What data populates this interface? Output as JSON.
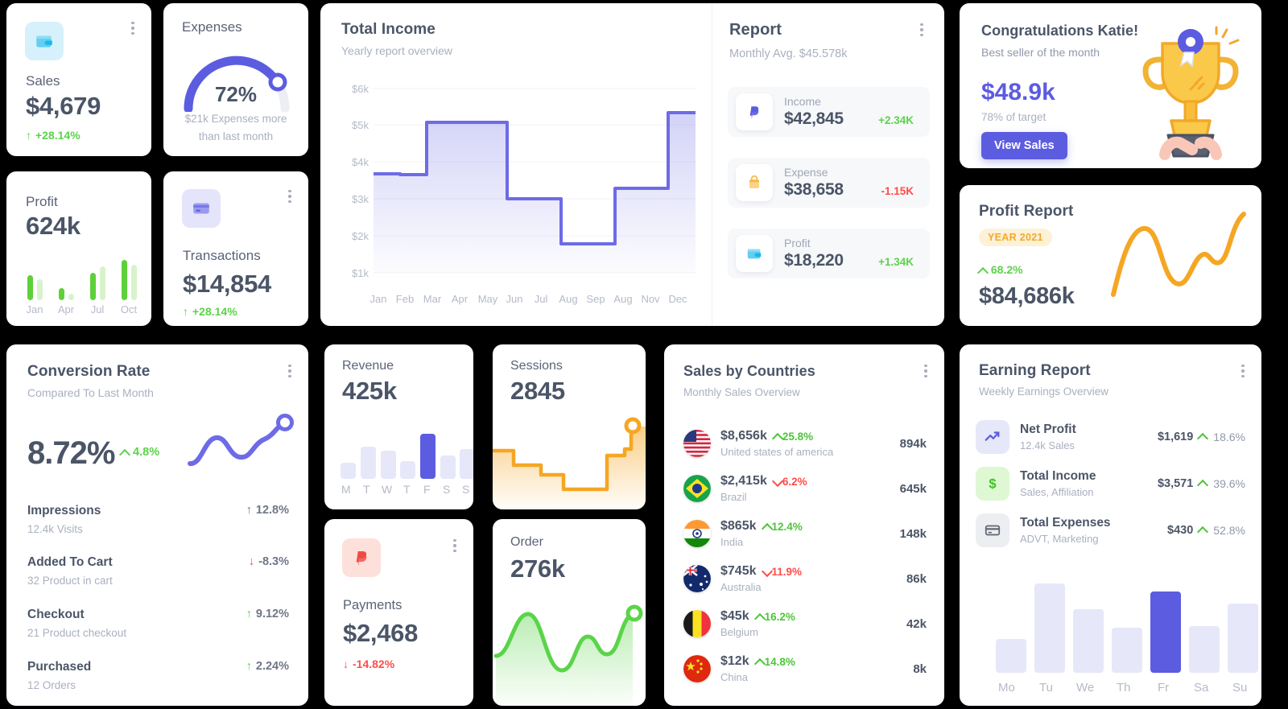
{
  "sales": {
    "icon": "wallet-icon",
    "label": "Sales",
    "value": "$4,679",
    "delta": "+28.14%"
  },
  "expenses": {
    "title": "Expenses",
    "percent": "72%",
    "percent_value": 72,
    "note_line1": "$21k Expenses more",
    "note_line2": "than last month"
  },
  "profit": {
    "label": "Profit",
    "value": "624k",
    "chart": {
      "type": "bar",
      "categories": [
        "Jan",
        "Apr",
        "Jul",
        "Oct"
      ],
      "series": [
        {
          "name": "primary",
          "color": "#5dd139",
          "values": [
            46,
            22,
            50,
            72
          ]
        },
        {
          "name": "secondary",
          "color": "#d8f3cb",
          "values": [
            38,
            12,
            62,
            64
          ]
        }
      ],
      "ylim": [
        0,
        80
      ]
    }
  },
  "transactions": {
    "icon": "credit-card-icon",
    "label": "Transactions",
    "value": "$14,854",
    "delta": "+28.14%"
  },
  "total_income": {
    "title": "Total Income",
    "subtitle": "Yearly report overview",
    "chart_data": {
      "type": "area",
      "title": "Total Income",
      "subtitle": "Yearly report overview",
      "xlabel": "",
      "ylabel": "",
      "categories": [
        "Jan",
        "Feb",
        "Mar",
        "Apr",
        "May",
        "Jun",
        "Jul",
        "Aug",
        "Sep",
        "Aug",
        "Nov",
        "Dec"
      ],
      "ytick_labels": [
        "$6k",
        "$5k",
        "$4k",
        "$3k",
        "$2k",
        "$1k"
      ],
      "yticks": [
        6000,
        5000,
        4000,
        3000,
        2000,
        1000
      ],
      "ylim": [
        1000,
        6000
      ],
      "values": [
        3300,
        3280,
        4680,
        4680,
        2980,
        2980,
        1760,
        1760,
        3580,
        3580,
        5700,
        5700
      ],
      "line_color": "#6d6be6",
      "grid": true,
      "legend": "none"
    }
  },
  "report": {
    "title": "Report",
    "subtitle": "Monthly Avg. $45.578k",
    "rows": [
      {
        "icon": "paypal-icon",
        "label": "Income",
        "value": "$42,845",
        "delta": "+2.34K",
        "dir": "up"
      },
      {
        "icon": "bag-icon",
        "label": "Expense",
        "value": "$38,658",
        "delta": "-1.15K",
        "dir": "down"
      },
      {
        "icon": "wallet-icon",
        "label": "Profit",
        "value": "$18,220",
        "delta": "+1.34K",
        "dir": "up"
      }
    ]
  },
  "congrats": {
    "title": "Congratulations Katie!",
    "subtitle": "Best seller of the month",
    "amount": "$48.9k",
    "target": "78% of target",
    "button": "View Sales",
    "illustration": "trophy-icon"
  },
  "profit_report": {
    "title": "Profit Report",
    "badge": "YEAR 2021",
    "delta": "68.2%",
    "value": "$84,686k",
    "chart": {
      "type": "line",
      "color": "#f5a623",
      "points": [
        20,
        14,
        8,
        22,
        32,
        24,
        14,
        20,
        4
      ]
    }
  },
  "conversion_rate": {
    "title": "Conversion Rate",
    "subtitle": "Compared To Last Month",
    "value": "8.72%",
    "delta": "4.8%",
    "chart": {
      "type": "line",
      "color": "#6d6be6"
    },
    "rows": [
      {
        "label": "Impressions",
        "sub": "12.4k Visits",
        "pct": "12.8%",
        "dir": "up"
      },
      {
        "label": "Added To Cart",
        "sub": "32 Product in cart",
        "pct": "-8.3%",
        "dir": "down"
      },
      {
        "label": "Checkout",
        "sub": "21 Product checkout",
        "pct": "9.12%",
        "dir": "up"
      },
      {
        "label": "Purchased",
        "sub": "12 Orders",
        "pct": "2.24%",
        "dir": "up"
      }
    ]
  },
  "revenue": {
    "label": "Revenue",
    "value": "425k",
    "chart": {
      "type": "bar",
      "categories": [
        "M",
        "T",
        "W",
        "T",
        "F",
        "S",
        "S"
      ],
      "values": [
        30,
        62,
        55,
        34,
        86,
        46,
        58
      ],
      "highlight_index": 4,
      "bar_color": "#e6e7f9",
      "highlight_color": "#5c5ce0",
      "ylim": [
        0,
        100
      ]
    }
  },
  "sessions": {
    "label": "Sessions",
    "value": "2845",
    "chart": {
      "type": "area",
      "color": "#f5a623",
      "values": [
        62,
        62,
        48,
        48,
        36,
        24,
        24,
        56,
        56,
        78
      ]
    }
  },
  "payments": {
    "icon": "paypal-icon",
    "label": "Payments",
    "value": "$2,468",
    "delta": "-14.82%"
  },
  "order": {
    "label": "Order",
    "value": "276k",
    "chart": {
      "type": "area",
      "color": "#5ad449"
    }
  },
  "sales_by_countries": {
    "title": "Sales by Countries",
    "subtitle": "Monthly Sales Overview",
    "rows": [
      {
        "flag": "flag-usa",
        "amount": "$8,656k",
        "pct": "25.8%",
        "dir": "up",
        "country": "United states of america",
        "total": "894k"
      },
      {
        "flag": "flag-brazil",
        "amount": "$2,415k",
        "pct": "6.2%",
        "dir": "down",
        "country": "Brazil",
        "total": "645k"
      },
      {
        "flag": "flag-india",
        "amount": "$865k",
        "pct": "12.4%",
        "dir": "up",
        "country": "India",
        "total": "148k"
      },
      {
        "flag": "flag-australia",
        "amount": "$745k",
        "pct": "11.9%",
        "dir": "down",
        "country": "Australia",
        "total": "86k"
      },
      {
        "flag": "flag-belgium",
        "amount": "$45k",
        "pct": "16.2%",
        "dir": "up",
        "country": "Belgium",
        "total": "42k"
      },
      {
        "flag": "flag-china",
        "amount": "$12k",
        "pct": "14.8%",
        "dir": "up",
        "country": "China",
        "total": "8k"
      }
    ]
  },
  "earning_report": {
    "title": "Earning Report",
    "subtitle": "Weekly Earnings Overview",
    "rows": [
      {
        "icon": "trending-up-icon",
        "label": "Net Profit",
        "sub": "12.4k Sales",
        "value": "$1,619",
        "pct": "18.6%",
        "dir": "up"
      },
      {
        "icon": "dollar-icon",
        "label": "Total Income",
        "sub": "Sales, Affiliation",
        "value": "$3,571",
        "pct": "39.6%",
        "dir": "up"
      },
      {
        "icon": "card-icon",
        "label": "Total Expenses",
        "sub": "ADVT, Marketing",
        "value": "$430",
        "pct": "52.8%",
        "dir": "up"
      }
    ],
    "chart": {
      "type": "bar",
      "categories": [
        "Mo",
        "Tu",
        "We",
        "Th",
        "Fr",
        "Sa",
        "Su"
      ],
      "values": [
        32,
        86,
        62,
        42,
        78,
        44,
        66
      ],
      "highlight_index": 4,
      "bar_color": "#e6e7f9",
      "highlight_color": "#5c5ce0",
      "ylim": [
        0,
        100
      ]
    }
  },
  "colors": {
    "accent": "#5c5ce0",
    "green": "#5ad449",
    "red": "#ff4d49",
    "orange": "#f5a623",
    "text": "#4b5567",
    "muted": "#a9b0c0"
  }
}
